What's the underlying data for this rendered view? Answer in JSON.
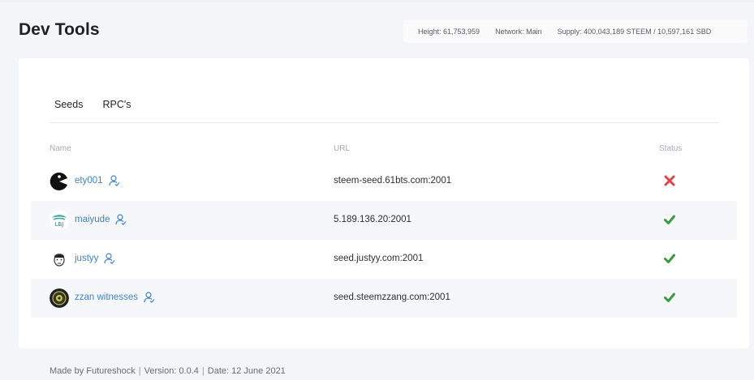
{
  "page": {
    "title": "Dev Tools"
  },
  "stats": {
    "height": "Height: 61,753,959",
    "network": "Network: Main",
    "supply": "Supply: 400,043,189 STEEM / 10,597,161 SBD"
  },
  "tabs": [
    {
      "label": "Seeds",
      "active": true
    },
    {
      "label": "RPC's",
      "active": false
    }
  ],
  "table": {
    "columns": {
      "name": "Name",
      "url": "URL",
      "status": "Status"
    },
    "rows": [
      {
        "name": "ety001",
        "url": "steem-seed.61bts.com:2001",
        "status": "offline",
        "avatar": "pacman-avatar"
      },
      {
        "name": "maiyude",
        "url": "5.189.136.20:2001",
        "status": "online",
        "avatar": "teal-logo-avatar"
      },
      {
        "name": "justyy",
        "url": "seed.justyy.com:2001",
        "status": "online",
        "avatar": "face-avatar"
      },
      {
        "name": "zzan witnesses",
        "url": "seed.steemzzang.com:2001",
        "status": "online",
        "avatar": "emblem-avatar"
      }
    ]
  },
  "footer": {
    "made_by": "Made by Futureshock",
    "separator": "|",
    "version": "Version: 0.0.4",
    "date": "Date: 12 June 2021"
  },
  "colors": {
    "link": "#3d82c6",
    "ok": "#3a9c3e",
    "error": "#e04444"
  },
  "icons": {
    "user": "user-check-icon",
    "online": "checkmark-icon",
    "offline": "cross-icon"
  }
}
